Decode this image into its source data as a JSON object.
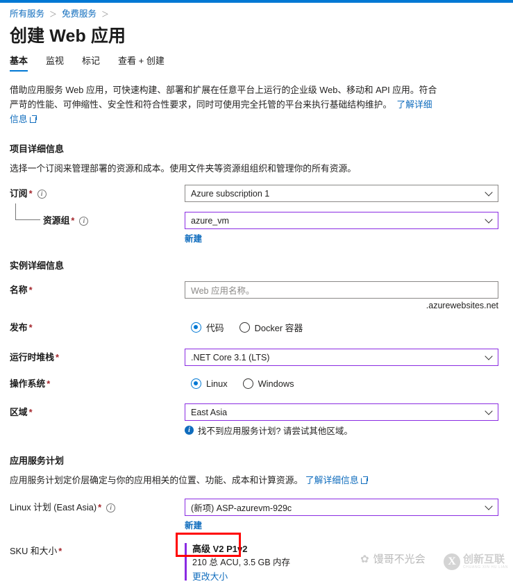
{
  "theme": {
    "accent": "#0078d4",
    "link": "#0f6cbd",
    "focus_border": "#8a2be2",
    "required_star": "#a4262c",
    "annotation": "#ff0000"
  },
  "breadcrumb": {
    "items": [
      {
        "label": "所有服务"
      },
      {
        "label": "免费服务"
      }
    ],
    "separator": "＞"
  },
  "header": {
    "title": "创建 Web 应用"
  },
  "tabs": [
    {
      "label": "基本",
      "active": true
    },
    {
      "label": "监视",
      "active": false
    },
    {
      "label": "标记",
      "active": false
    },
    {
      "label": "查看 + 创建",
      "active": false
    }
  ],
  "intro": {
    "text": "借助应用服务 Web 应用，可快速构建、部署和扩展在任意平台上运行的企业级 Web、移动和 API 应用。符合严苛的性能、可伸缩性、安全性和符合性要求，同时可使用完全托管的平台来执行基础结构维护。",
    "link": "了解详细信息"
  },
  "project_section": {
    "title": "项目详细信息",
    "description": "选择一个订阅来管理部署的资源和成本。使用文件夹等资源组组织和管理你的所有资源。",
    "subscription": {
      "label": "订阅",
      "required": "*",
      "value": "Azure subscription 1"
    },
    "resource_group": {
      "label": "资源组",
      "required": "*",
      "value": "azure_vm",
      "new_link": "新建"
    }
  },
  "instance_section": {
    "title": "实例详细信息",
    "name": {
      "label": "名称",
      "required": "*",
      "value": "",
      "placeholder": "Web 应用名称。",
      "suffix": ".azurewebsites.net"
    },
    "publish": {
      "label": "发布",
      "required": "*",
      "options": [
        {
          "label": "代码",
          "selected": true
        },
        {
          "label": "Docker 容器",
          "selected": false
        }
      ]
    },
    "runtime_stack": {
      "label": "运行时堆栈",
      "required": "*",
      "value": ".NET Core 3.1 (LTS)"
    },
    "operating_system": {
      "label": "操作系统",
      "required": "*",
      "options": [
        {
          "label": "Linux",
          "selected": true
        },
        {
          "label": "Windows",
          "selected": false
        }
      ]
    },
    "region": {
      "label": "区域",
      "required": "*",
      "value": "East Asia",
      "note": "找不到应用服务计划? 请尝试其他区域。",
      "note_icon": "info-icon"
    }
  },
  "plan_section": {
    "title": "应用服务计划",
    "description": "应用服务计划定价层确定与你的应用相关的位置、功能、成本和计算资源。",
    "description_link": "了解详细信息",
    "linux_plan": {
      "label": "Linux 计划 (East Asia)",
      "required": "*",
      "value": "(新项) ASP-azurevm-929c",
      "new_link": "新建"
    },
    "sku": {
      "label": "SKU 和大小",
      "required": "*",
      "title": "高级 V2 P1v2",
      "detail": "210 总 ACU, 3.5 GB 内存",
      "change_link": "更改大小"
    }
  },
  "watermarks": {
    "wechat": {
      "glyph": "✿",
      "text": "馒哥不光会"
    },
    "logo": {
      "mark": "X",
      "name": "创新互联",
      "pinyin": "CHUANG XIN HU LIAN"
    }
  }
}
